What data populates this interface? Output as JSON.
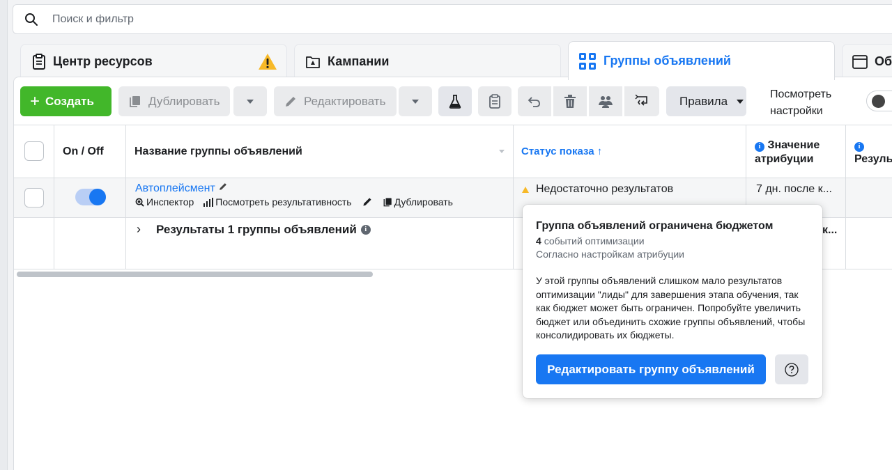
{
  "search": {
    "placeholder": "Поиск и фильтр"
  },
  "tabs": [
    {
      "label": "Центр ресурсов",
      "icon": "clipboard-icon"
    },
    {
      "label": "Кампании",
      "icon": "folder-icon"
    },
    {
      "label": "Группы объявлений",
      "icon": "grid-icon"
    },
    {
      "label": "Об",
      "icon": "window-icon"
    }
  ],
  "toolbar": {
    "create_label": "Создать",
    "duplicate_label": "Дублировать",
    "edit_label": "Редактировать",
    "rules_label": "Правила",
    "view_settings_line1": "Посмотреть",
    "view_settings_line2": "настройки"
  },
  "table": {
    "headers": {
      "onoff": "On / Off",
      "name": "Название группы объявлений",
      "status": "Статус показа",
      "status_sort": "↑",
      "attribution_line1": "Значение",
      "attribution_line2": "атрибуции",
      "results": "Резуль"
    },
    "row": {
      "name": "Автоплейсмент",
      "actions": [
        "Инспектор",
        "Посмотреть результативность",
        "Дублировать"
      ],
      "status": "Недостаточно результатов",
      "attribution": "7 дн. после к...",
      "toggle_on": true
    },
    "summary": {
      "label": "Результаты 1 группы объявлений",
      "attribution": "к..."
    }
  },
  "popover": {
    "title": "Группа объявлений ограничена бюджетом",
    "count": "4",
    "count_suffix": "событий оптимизации",
    "attribution_note": "Согласно настройкам атрибуции",
    "body": "У этой группы объявлений слишком мало результатов оптимизации \"лиды\" для завершения этапа обучения, так как бюджет может быть ограничен. Попробуйте увеличить бюджет или объединить схожие группы объявлений, чтобы консолидировать их бюджеты.",
    "edit_button": "Редактировать группу объявлений",
    "help_icon": "question-icon"
  },
  "colors": {
    "brand_blue": "#1877f2",
    "create_green": "#42b72a",
    "warning_yellow": "#f7b928"
  }
}
